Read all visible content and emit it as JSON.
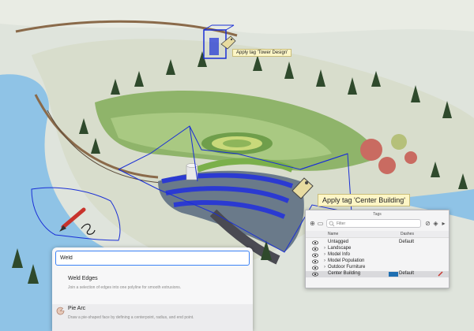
{
  "scene": {
    "tooltip_tower": "Apply tag 'Tower Design'",
    "tooltip_center": "Apply tag 'Center Building'"
  },
  "search": {
    "value": "Weld",
    "results": [
      {
        "title": "Weld Edges",
        "description": "Join a selection of edges into one polyline for smooth extrusions.",
        "icon": "none"
      },
      {
        "title": "Pie Arc",
        "description": "Draw a pie-shaped face by defining a centerpoint, radius, and end point.",
        "icon": "pie-arc-icon"
      }
    ]
  },
  "tags_panel": {
    "title": "Tags",
    "filter_placeholder": "Filter",
    "columns": {
      "name": "Name",
      "dashes": "Dashes"
    },
    "rows": [
      {
        "name": "Untagged",
        "dashes": "Default",
        "expandable": false,
        "selected": false
      },
      {
        "name": "Landscape",
        "dashes": "",
        "expandable": true,
        "selected": false
      },
      {
        "name": "Model Info",
        "dashes": "",
        "expandable": true,
        "selected": false
      },
      {
        "name": "Model Population",
        "dashes": "",
        "expandable": true,
        "selected": false
      },
      {
        "name": "Outdoor Furniture",
        "dashes": "",
        "expandable": true,
        "selected": false
      },
      {
        "name": "Center Building",
        "dashes": "Default",
        "expandable": false,
        "selected": true,
        "color": "#1f6fb2"
      }
    ]
  },
  "colors": {
    "water": "#8fc3e6",
    "land": "#dfe2d5",
    "selection_blue": "#1a2fd6",
    "tooltip_bg": "#fdf6c6",
    "tag_color": "#1f6fb2"
  }
}
